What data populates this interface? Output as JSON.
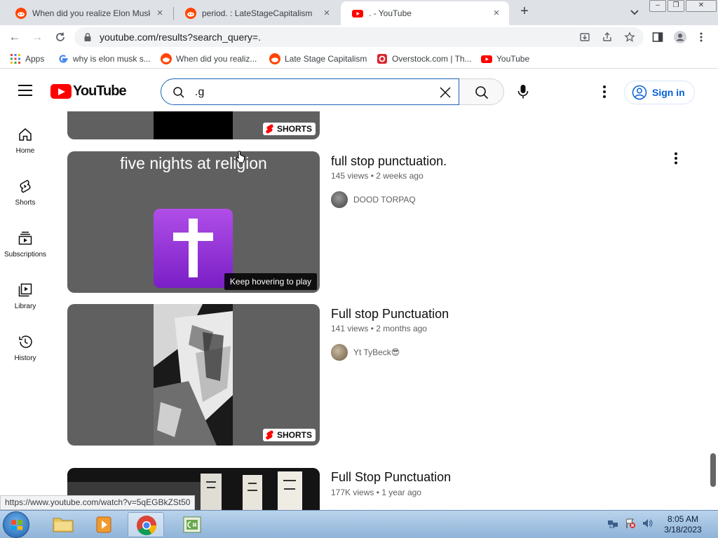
{
  "browser": {
    "tabs": [
      {
        "title": "When did you realize Elon Musk",
        "favicon": "reddit-icon",
        "active": false
      },
      {
        "title": "period. : LateStageCapitalism",
        "favicon": "reddit-icon",
        "active": false
      },
      {
        "title": ". - YouTube",
        "favicon": "youtube-icon",
        "active": true
      }
    ],
    "new_tab_label": "+",
    "url": "youtube.com/results?search_query=.",
    "bookmarks": [
      {
        "label": "Apps",
        "icon": "apps-grid-icon"
      },
      {
        "label": "why is elon musk s...",
        "icon": "google-icon"
      },
      {
        "label": "When did you realiz...",
        "icon": "reddit-icon"
      },
      {
        "label": "Late Stage Capitalism",
        "icon": "reddit-icon"
      },
      {
        "label": "Overstock.com | Th...",
        "icon": "overstock-icon"
      },
      {
        "label": "YouTube",
        "icon": "youtube-icon"
      }
    ],
    "status_url": "https://www.youtube.com/watch?v=5qEGBkZSt50"
  },
  "youtube": {
    "logo_text": "YouTube",
    "search_value": ".g",
    "signin_label": "Sign in",
    "guide": [
      {
        "label": "Home",
        "icon": "home-icon"
      },
      {
        "label": "Shorts",
        "icon": "shorts-icon"
      },
      {
        "label": "Subscriptions",
        "icon": "subscriptions-icon"
      },
      {
        "label": "Library",
        "icon": "library-icon"
      },
      {
        "label": "History",
        "icon": "history-icon"
      }
    ],
    "shorts_badge": "SHORTS",
    "results": [
      {
        "title": "full stop punctuation.",
        "views": "145 views",
        "age": "2 weeks ago",
        "channel": "DOOD TORPAQ",
        "thumb_caption": "five nights at religion",
        "hover_tip": "Keep hovering to play"
      },
      {
        "title": "Full stop Punctuation",
        "views": "141 views",
        "age": "2 months ago",
        "channel": "Yt TyBeck😎"
      },
      {
        "title": "Full Stop Punctuation",
        "views": "177K views",
        "age": "1 year ago"
      }
    ]
  },
  "taskbar": {
    "time": "8:05 AM",
    "date": "3/18/2023"
  },
  "colors": {
    "youtube_red": "#ff0000",
    "link_blue": "#065fd4",
    "tabstrip_bg": "#dee1e6"
  }
}
